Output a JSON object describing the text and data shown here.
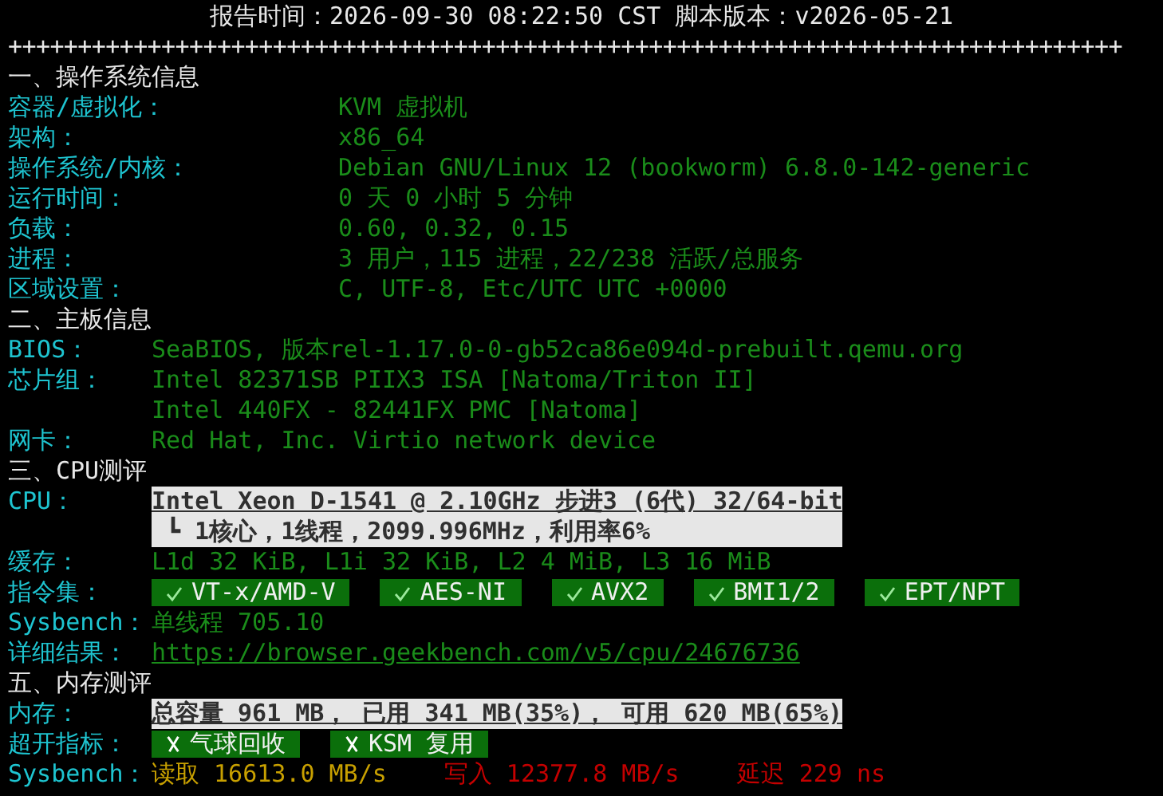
{
  "header": {
    "title": "报告时间：2026-09-30 08:22:50 CST  脚本版本：v2026-05-21",
    "divider": "++++++++++++++++++++++++++++++++++++++++++++++++++++++++++++++++++++++++++++++++"
  },
  "sections": [
    {
      "title": "一、操作系统信息",
      "rows": [
        {
          "kind": "text",
          "label": "容器/虚拟化：",
          "values": [
            "KVM 虚拟机"
          ]
        },
        {
          "kind": "text",
          "label": "架构：",
          "values": [
            "x86_64"
          ]
        },
        {
          "kind": "text",
          "label": "操作系统/内核：",
          "values": [
            "Debian GNU/Linux 12 (bookworm) 6.8.0-142-generic"
          ]
        },
        {
          "kind": "text",
          "label": "运行时间：",
          "values": [
            "0 天 0 小时 5 分钟"
          ]
        },
        {
          "kind": "text",
          "label": "负载：",
          "values": [
            "0.60, 0.32, 0.15"
          ]
        },
        {
          "kind": "text",
          "label": "进程：",
          "values": [
            "3 用户，115 进程，22/238 活跃/总服务"
          ]
        },
        {
          "kind": "text",
          "label": "区域设置：",
          "values": [
            "C, UTF-8, Etc/UTC UTC +0000"
          ]
        }
      ]
    },
    {
      "title": "二、主板信息",
      "rows": [
        {
          "kind": "text",
          "label": "BIOS：",
          "values": [
            "SeaBIOS, 版本rel-1.17.0-0-gb52ca86e094d-prebuilt.qemu.org"
          ]
        },
        {
          "kind": "text",
          "label": "芯片组：",
          "values": [
            "Intel 82371SB PIIX3 ISA [Natoma/Triton II]",
            "Intel 440FX - 82441FX PMC [Natoma]"
          ]
        },
        {
          "kind": "text",
          "label": "网卡：",
          "values": [
            "Red Hat, Inc. Virtio network device"
          ]
        }
      ]
    },
    {
      "title": "三、CPU测评",
      "rows": [
        {
          "kind": "highlight",
          "label": "CPU：",
          "values": [
            "Intel Xeon D-1541 @ 2.10GHz 步进3 (6代) 32/64-bit",
            "┗ 1核心，1线程，2099.996MHz，利用率6%"
          ]
        },
        {
          "kind": "text",
          "label": "缓存：",
          "values": [
            "L1d 32 KiB, L1i 32 KiB, L2 4 MiB, L3 16 MiB"
          ]
        },
        {
          "kind": "badges",
          "label": "指令集：",
          "badges": [
            {
              "text": "VT-x/AMD-V",
              "checked": true
            },
            {
              "text": "AES-NI",
              "checked": true
            },
            {
              "text": "AVX2",
              "checked": true
            },
            {
              "text": "BMI1/2",
              "checked": true
            },
            {
              "text": "EPT/NPT",
              "checked": true
            }
          ]
        },
        {
          "kind": "text",
          "label": "Sysbench：",
          "values": [
            "单线程 705.10"
          ]
        },
        {
          "kind": "link",
          "label": "详细结果：",
          "values": [
            "https://browser.geekbench.com/v5/cpu/24676736"
          ]
        }
      ]
    },
    {
      "title": "五、内存测评",
      "rows": [
        {
          "kind": "highlight",
          "label": "内存：",
          "values": [
            "总容量 961 MB， 已用 341 MB(35%)， 可用 620 MB(65%)"
          ]
        },
        {
          "kind": "badges",
          "label": "超开指标：",
          "badges": [
            {
              "text": "气球回收",
              "checked": false
            },
            {
              "text": "KSM 复用",
              "checked": false
            }
          ]
        },
        {
          "kind": "bench",
          "label": "Sysbench：",
          "parts": [
            {
              "text": "读取 16613.0 MB/s",
              "color": "#c8a000"
            },
            {
              "text": "写入 12377.8 MB/s",
              "color": "#c40000"
            },
            {
              "text": "延迟 229 ns",
              "color": "#c40000"
            }
          ]
        }
      ]
    }
  ]
}
